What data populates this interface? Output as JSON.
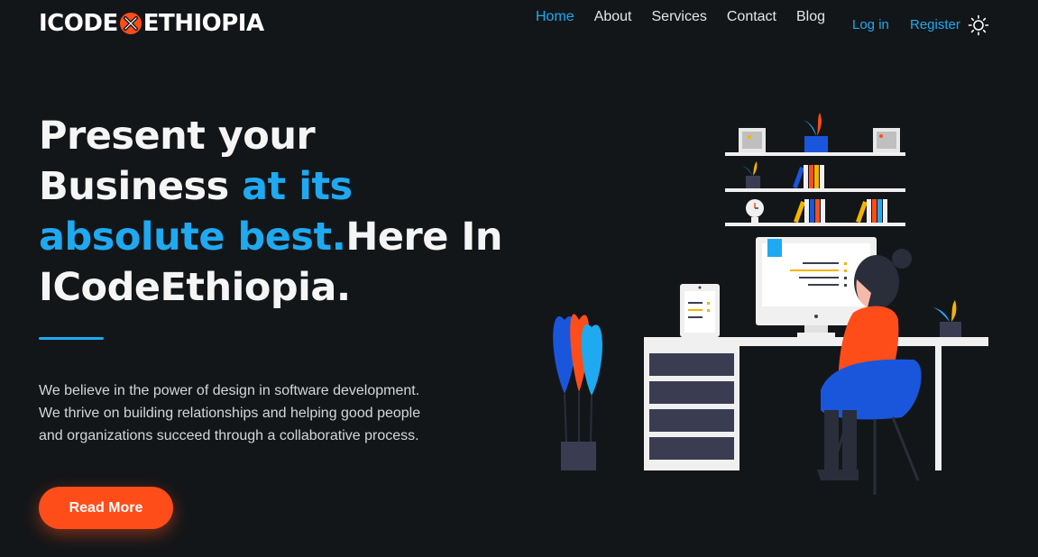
{
  "header": {
    "logo": {
      "part1": "ICODE",
      "part2": "ETHIOPIA",
      "icon": "x-logo-icon"
    },
    "nav": [
      {
        "label": "Home",
        "active": true
      },
      {
        "label": "About",
        "active": false
      },
      {
        "label": "Services",
        "active": false
      },
      {
        "label": "Contact",
        "active": false
      },
      {
        "label": "Blog",
        "active": false
      }
    ],
    "login_label": "Log in",
    "register_label": "Register",
    "theme_icon": "sun-icon"
  },
  "hero": {
    "title_line1": "Present your",
    "title_line2_a": "Business ",
    "title_line2_b": "at its",
    "title_line3_a": "absolute best.",
    "title_line3_b": "Here In",
    "title_line4": "ICodeEthiopia.",
    "description_line1": "We believe in the power of design in software development.",
    "description_line2": "We thrive on building relationships and helping good people",
    "description_line3": "and organizations succeed through a collaborative process.",
    "button_label": "Read More"
  },
  "colors": {
    "background": "#131619",
    "accent": "#1fa9f0",
    "button": "#ff4d1a"
  },
  "illustration": {
    "icon": "workspace-illustration"
  }
}
